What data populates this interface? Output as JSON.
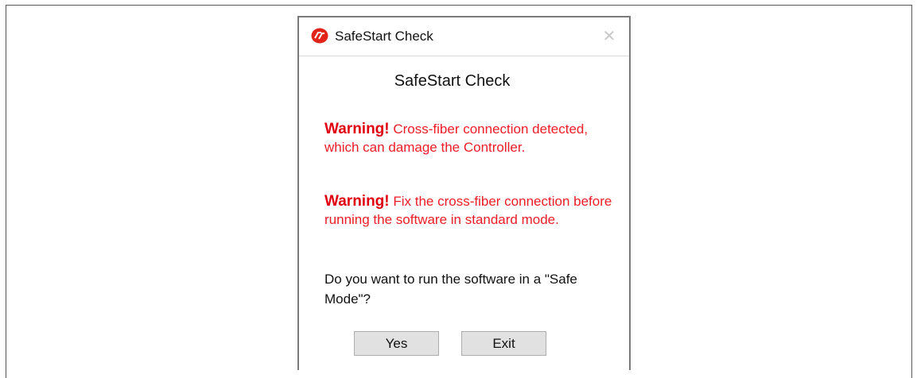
{
  "dialog": {
    "window_title": "SafeStart Check",
    "heading": "SafeStart Check",
    "close_glyph": "✕",
    "warnings": [
      {
        "label": "Warning!",
        "text": "Cross-fiber connection detected, which can damage the Controller."
      },
      {
        "label": "Warning!",
        "text": "Fix the cross-fiber connection before running the software in standard mode."
      }
    ],
    "question": "Do you want to run the software in a \"Safe Mode\"?",
    "buttons": {
      "yes": "Yes",
      "exit": "Exit"
    },
    "icons": {
      "app_logo": "app-logo-icon",
      "close": "close-icon"
    },
    "colors": {
      "warning": "#ef1c25",
      "logo": "#e2231a"
    }
  }
}
